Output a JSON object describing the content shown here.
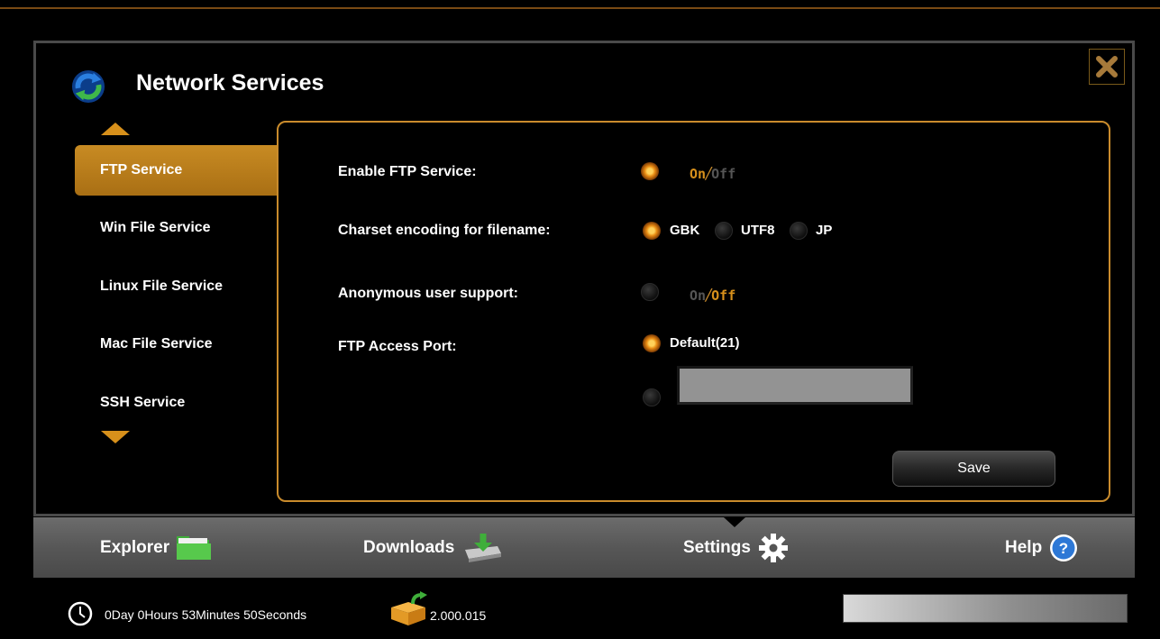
{
  "header": {
    "title": "Network Services"
  },
  "sidebar": {
    "items": [
      {
        "label": "FTP Service",
        "active": true
      },
      {
        "label": "Win File Service",
        "active": false
      },
      {
        "label": "Linux File Service",
        "active": false
      },
      {
        "label": "Mac File Service",
        "active": false
      },
      {
        "label": "SSH Service",
        "active": false
      }
    ]
  },
  "ftp": {
    "enable": {
      "label": "Enable FTP Service:",
      "on": "On",
      "off": "Off",
      "selected": "On"
    },
    "charset": {
      "label": "Charset encoding for filename:",
      "options": [
        "GBK",
        "UTF8",
        "JP"
      ],
      "selected": "GBK"
    },
    "anonymous": {
      "label": "Anonymous user support:",
      "on": "On",
      "off": "Off",
      "selected": "Off"
    },
    "port": {
      "label": "FTP Access Port:",
      "default_option": "Default(21)",
      "custom_value": "",
      "selected": "default"
    },
    "save_label": "Save"
  },
  "nav": {
    "tabs": [
      {
        "label": "Explorer",
        "icon": "folder-icon"
      },
      {
        "label": "Downloads",
        "icon": "download-icon"
      },
      {
        "label": "Settings",
        "icon": "gear-icon",
        "active": true
      },
      {
        "label": "Help",
        "icon": "help-icon"
      }
    ]
  },
  "status": {
    "uptime": "0Day 0Hours 53Minutes 50Seconds",
    "version": "2.000.015"
  },
  "colors": {
    "accent": "#d7901b",
    "border": "#c98b2c",
    "background": "#000000"
  }
}
